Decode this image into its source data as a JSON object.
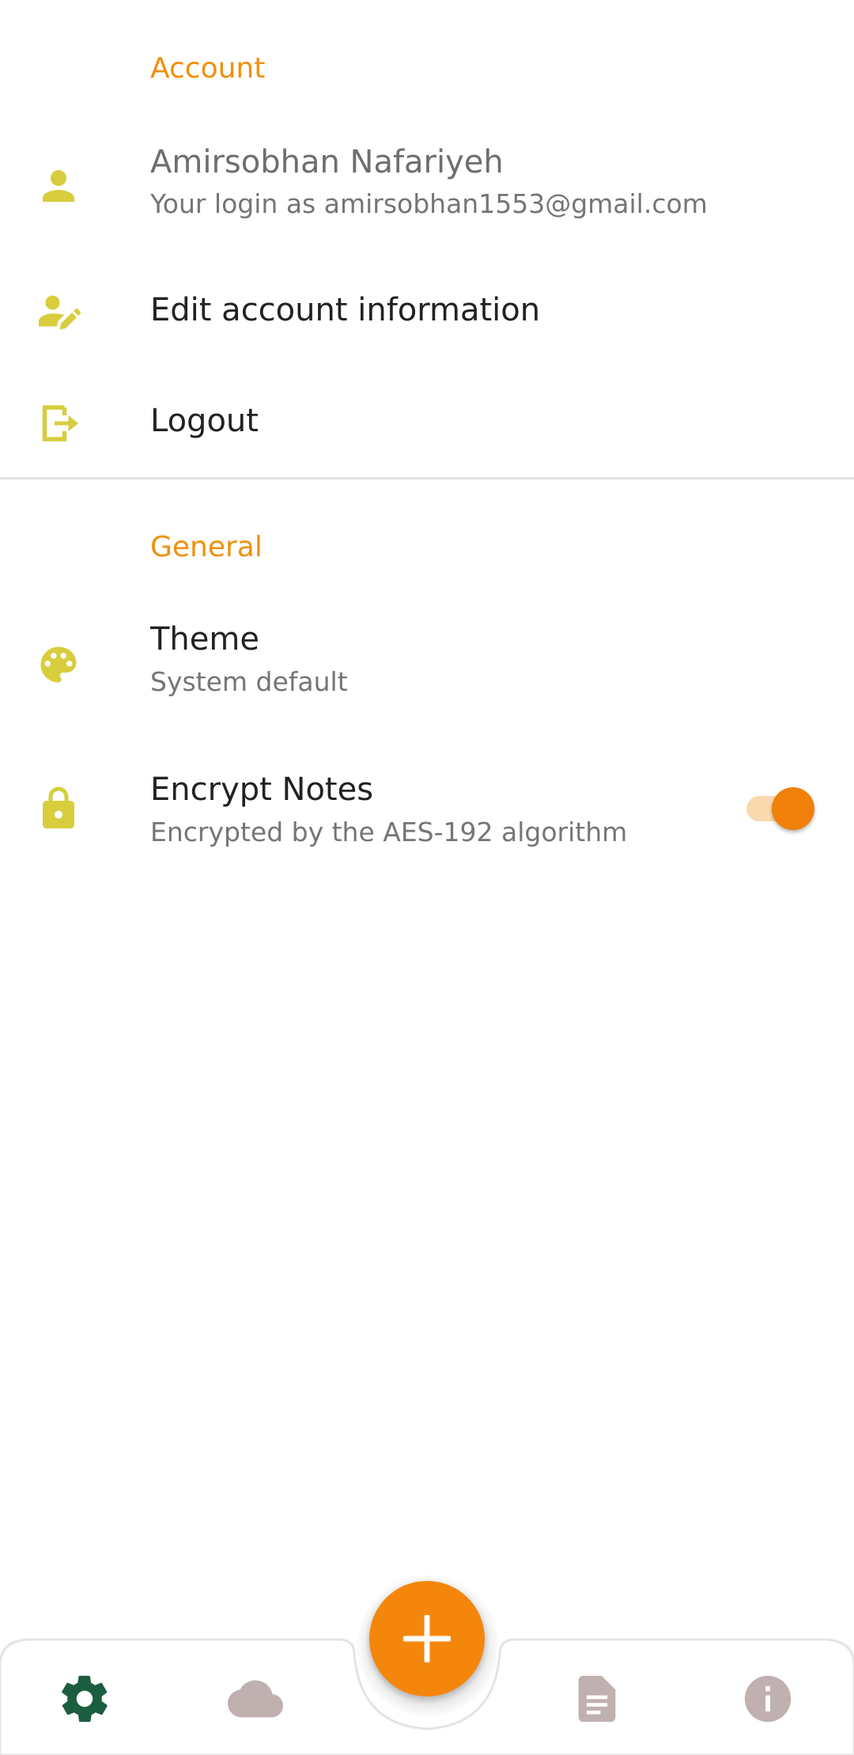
{
  "account_section": {
    "header": "Account",
    "profile": {
      "name": "Amirsobhan Nafariyeh",
      "login_text": "Your login as amirsobhan1553@gmail.com",
      "icon": "person-icon"
    },
    "edit_account": {
      "label": "Edit account information",
      "icon": "person-edit-icon"
    },
    "logout": {
      "label": "Logout",
      "icon": "logout-icon"
    }
  },
  "general_section": {
    "header": "General",
    "theme": {
      "label": "Theme",
      "value": "System default",
      "icon": "palette-icon"
    },
    "encrypt_notes": {
      "label": "Encrypt Notes",
      "description": "Encrypted by the AES-192 algorithm",
      "enabled": true,
      "icon": "lock-icon"
    }
  },
  "bottom_nav": {
    "items": [
      {
        "icon": "settings-icon",
        "active": true
      },
      {
        "icon": "cloud-icon",
        "active": false
      },
      {
        "icon": "notes-icon",
        "active": false
      },
      {
        "icon": "info-icon",
        "active": false
      }
    ],
    "fab_icon": "plus-icon"
  },
  "colors": {
    "accent": "#f0900a",
    "icon": "#d8cd3c",
    "nav_active": "#1b5e3f",
    "nav_inactive": "#c1b0b0",
    "fab": "#f5860c"
  }
}
